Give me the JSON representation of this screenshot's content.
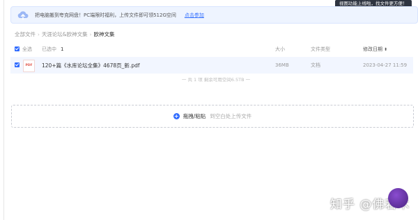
{
  "banner": {
    "text": "把电脑搬到夸克网盘！PC端限时福利，上传文件即可领512G空间",
    "link": "点击参加"
  },
  "tooltip": "视图功能上线啦，找文件更方便！",
  "breadcrumb": {
    "items": [
      "全部文件",
      "天涯论坛&欧神文集",
      "欧神文集"
    ]
  },
  "header": {
    "select_all": "全选",
    "selected_label": "已选中",
    "selected_count": "1",
    "size": "大小",
    "type": "文件类型",
    "date": "修改日期"
  },
  "files": [
    {
      "icon_label": "PDF",
      "name": "120+篇《水库论坛全集》4678页_新.pdf",
      "size": "36MB",
      "type": "文档",
      "date": "2023-04-27 11:59"
    }
  ],
  "summary": "一 共 1 项 剩余可用空间6.5TB 一",
  "dropzone": {
    "action": "拖拽/粘贴",
    "hint": "到空白处上传文件"
  },
  "watermark": "知乎 @佛若木",
  "colors": {
    "accent": "#2f6bff",
    "banner_bg": "#eef4ff",
    "row_selected_bg": "#f2f6ff",
    "pdf_red": "#e0564b"
  }
}
